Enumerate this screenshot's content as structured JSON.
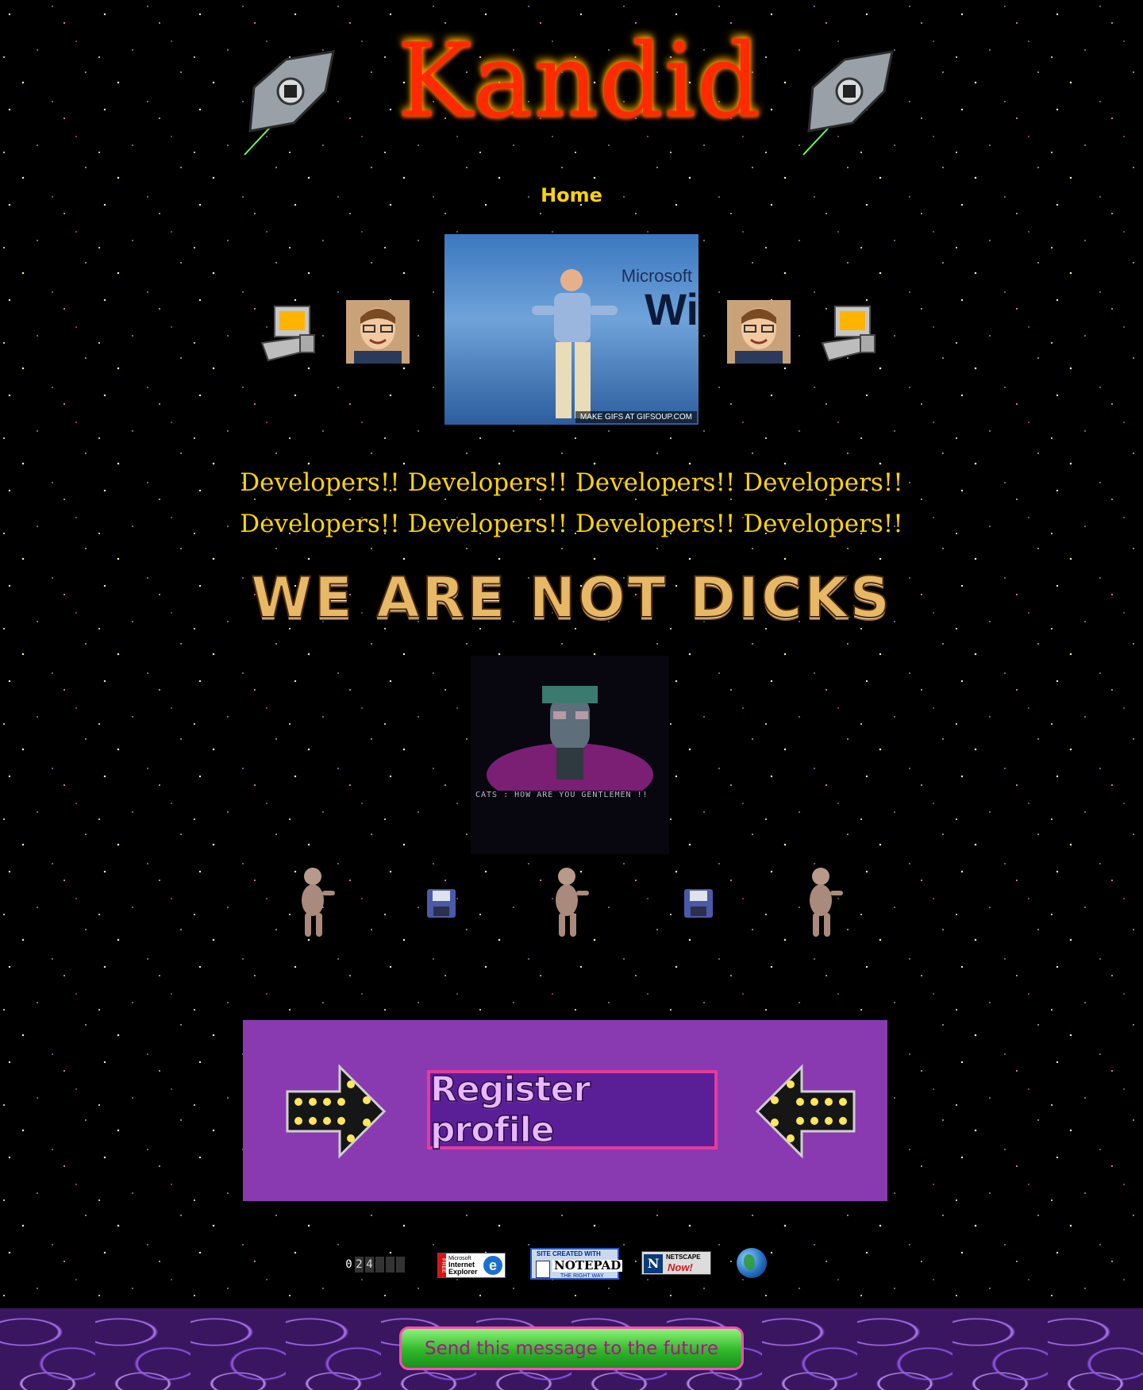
{
  "header": {
    "logo_text": "Kandid",
    "logo_icon": "fire-logo-icon",
    "ship_icon": "tie-fighter-icon"
  },
  "nav": {
    "home_label": "Home"
  },
  "hero": {
    "logo_small": "Microsoft",
    "logo_big": "Wi",
    "caption": "MAKE GIFS AT GIFSOUP.COM",
    "portrait_icon": "bill-gates-portrait-icon",
    "computer_icon": "old-computer-icon"
  },
  "developers": {
    "line1": "Developers!! Developers!! Developers!! Developers!!",
    "line2": "Developers!! Developers!! Developers!! Developers!!"
  },
  "banner": {
    "text": "WE ARE NOT DICKS"
  },
  "cats_gif": {
    "text": "CATS : HOW ARE YOU GENTLEMEN !!"
  },
  "dancing_row": {
    "baby_icon": "dancing-baby-icon",
    "floppy_icon": "floppy-disk-icon"
  },
  "register": {
    "label": "Register profile",
    "arrow_icon": "marquee-arrow-icon"
  },
  "badges": {
    "counter_digits": [
      "0",
      "2",
      "4",
      "",
      "",
      ""
    ],
    "ie": {
      "free": "FREE",
      "line1": "Microsoft",
      "line2": "Internet",
      "line3": "Explorer",
      "glyph": "e"
    },
    "notepad": {
      "top": "SITE CREATED WITH",
      "name": "NOTEPAD",
      "bottom": "THE RIGHT WAY"
    },
    "netscape": {
      "glyph": "N",
      "name": "NETSCAPE",
      "now": "Now!"
    },
    "globe_icon": "globe-icon"
  },
  "footer": {
    "button_label": "Send this message to the future"
  },
  "colors": {
    "accent_yellow": "#ffd400",
    "panel_purple": "#8a3ab0",
    "button_green": "#2fb82a"
  }
}
